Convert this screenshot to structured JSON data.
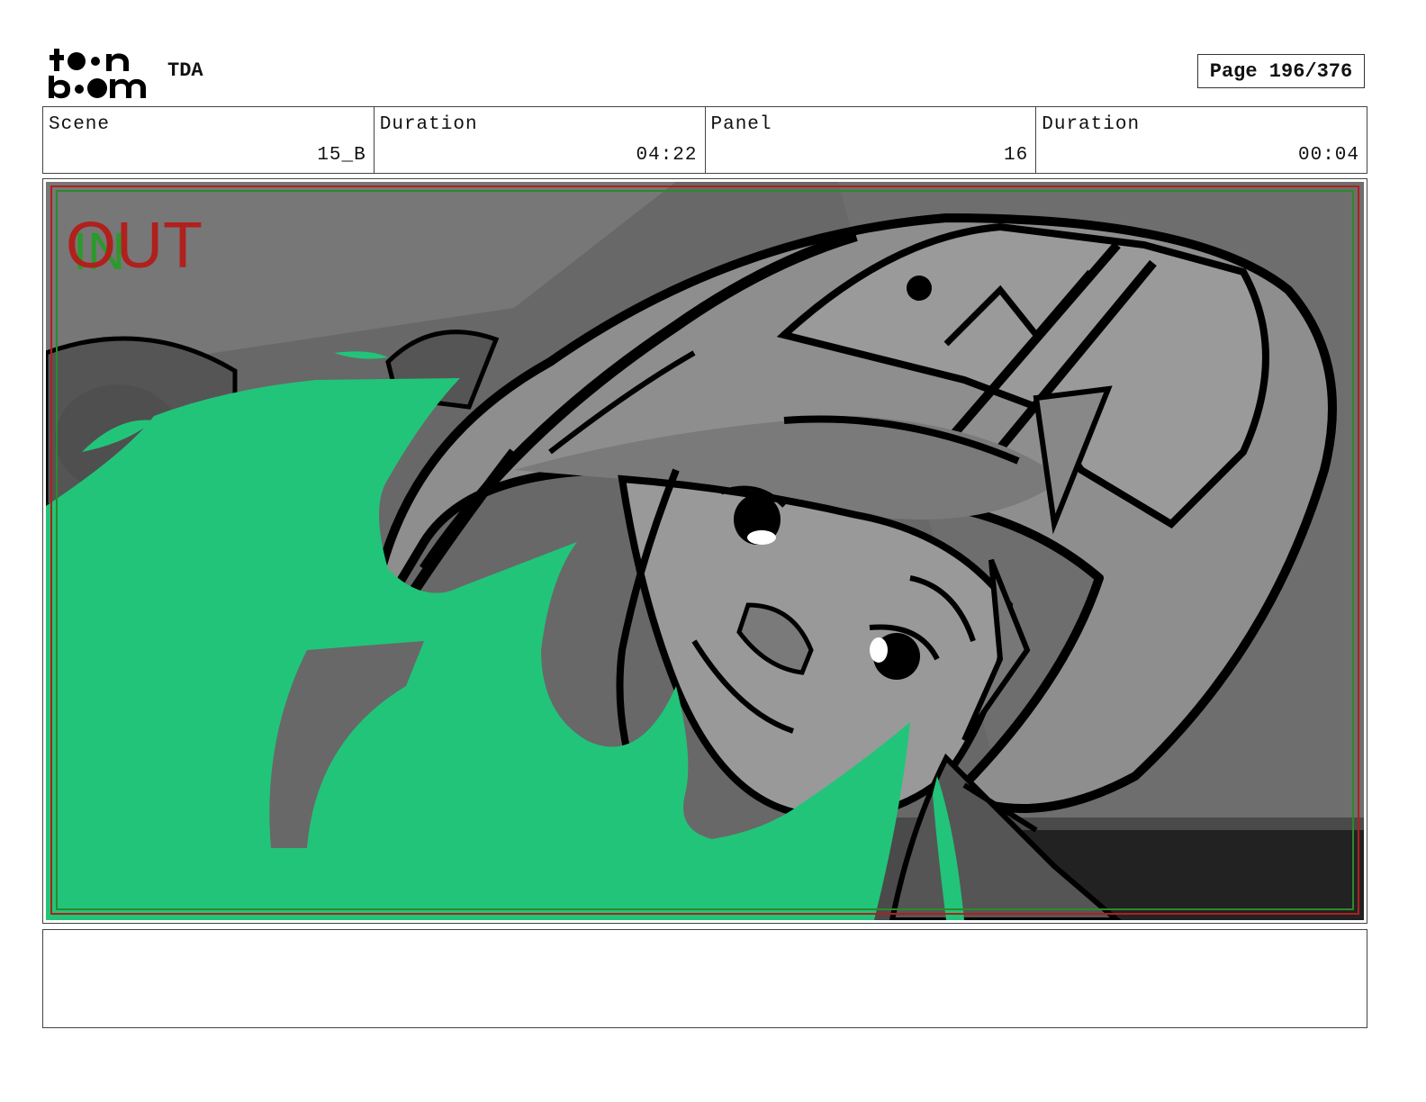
{
  "header": {
    "logo_text": [
      "toon",
      "boom"
    ],
    "project": "TDA",
    "page": "Page 196/376"
  },
  "info": [
    {
      "label": "Scene",
      "value": "15_B"
    },
    {
      "label": "Duration",
      "value": "04:22"
    },
    {
      "label": "Panel",
      "value": "16"
    },
    {
      "label": "Duration",
      "value": "00:04"
    }
  ],
  "panel": {
    "overlay_in": "IN",
    "overlay_out": "OUT",
    "colors": {
      "flame_green": "#22c47a",
      "safe_red": "#b0201c",
      "safe_green": "#2a8a2a"
    }
  },
  "notes": ""
}
